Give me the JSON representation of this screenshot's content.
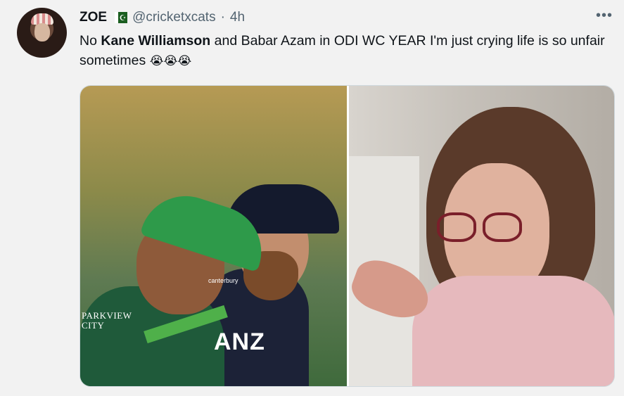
{
  "tweet": {
    "display_name": "ZOE",
    "handle": "@cricketxcats",
    "separator": "·",
    "time": "4h",
    "more_label": "•••",
    "text_prefix": "No ",
    "text_bold": "Kane Williamson",
    "text_rest": " and Babar Azam in ODI WC YEAR I'm just crying life is so unfair sometimes ",
    "emojis": "😭😭😭"
  },
  "media": {
    "left_photo_text_1": "PARKVIEW",
    "left_photo_text_2": "CITY",
    "left_photo_brand": "ANZ",
    "left_photo_sponsor": "canterbury"
  },
  "colors": {
    "background": "#f2f2f2",
    "text": "#0f1419",
    "muted": "#536471"
  }
}
